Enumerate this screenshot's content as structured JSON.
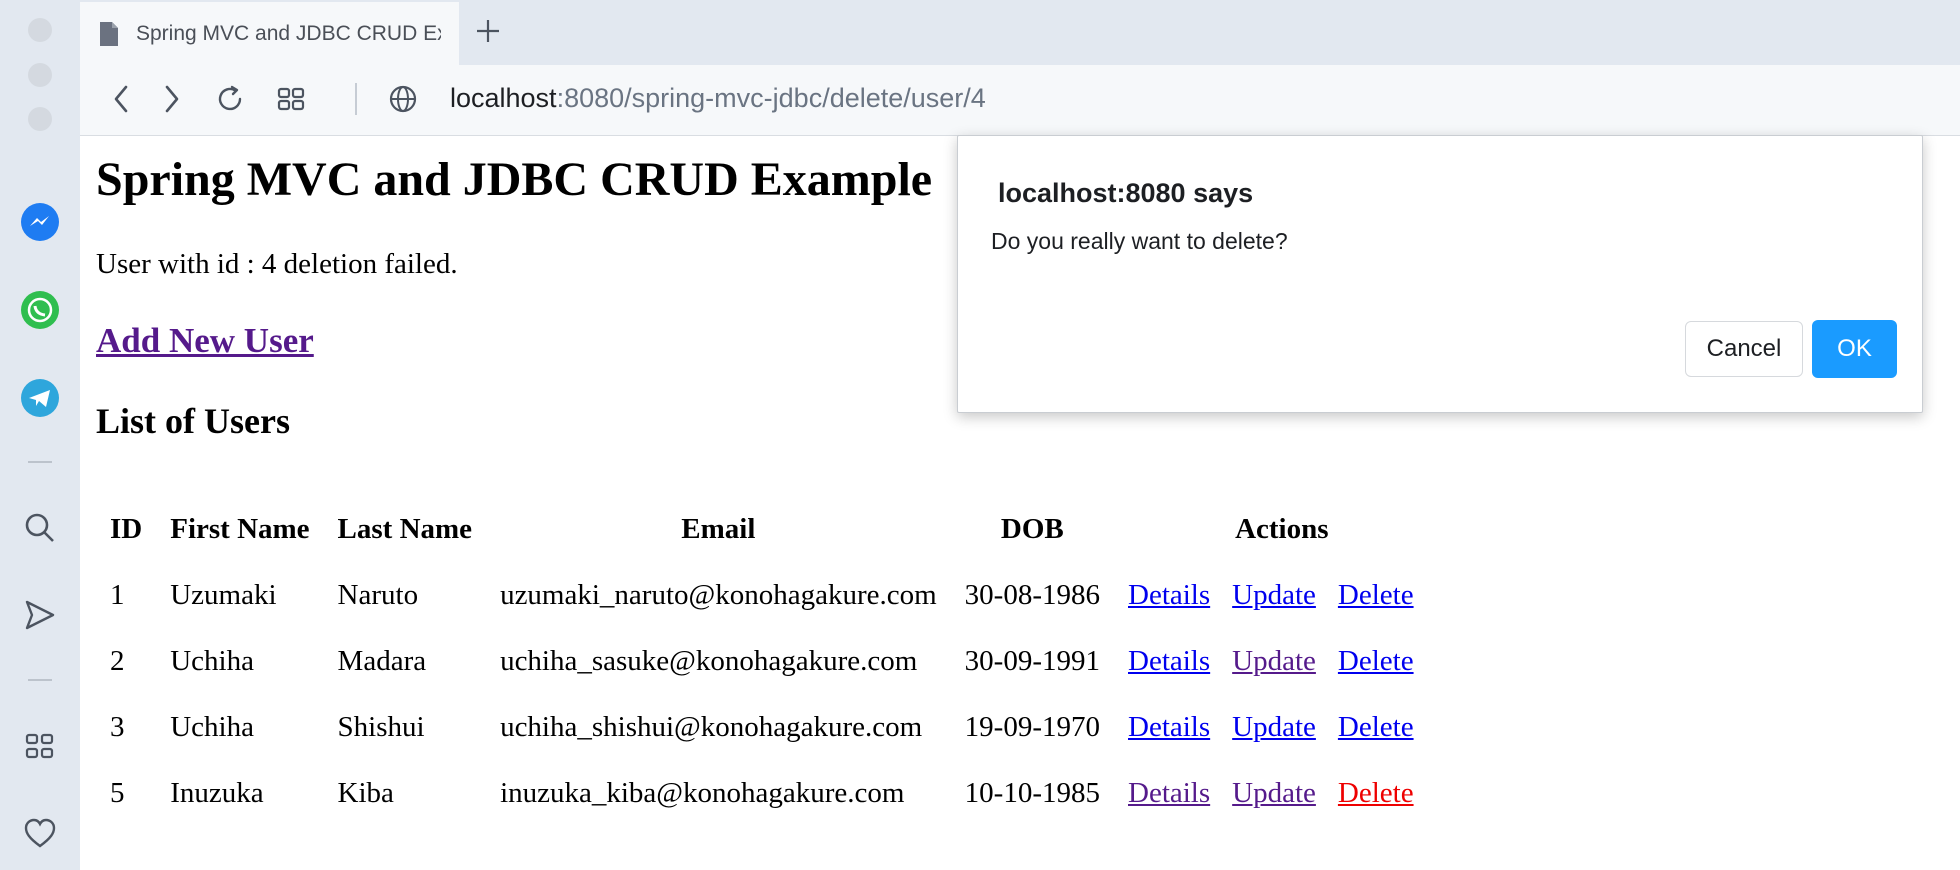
{
  "browser": {
    "tab": {
      "title": "Spring MVC and JDBC CRUD Example"
    },
    "url": {
      "host": "localhost",
      "path": ":8080/spring-mvc-jdbc/delete/user/4"
    }
  },
  "sidebar": {
    "items": [
      {
        "icon": "messenger-icon"
      },
      {
        "icon": "whatsapp-icon"
      },
      {
        "icon": "telegram-icon"
      },
      {
        "icon": "search-icon"
      },
      {
        "icon": "send-icon"
      },
      {
        "icon": "apps-grid-icon"
      },
      {
        "icon": "heart-icon"
      }
    ]
  },
  "page": {
    "title": "Spring MVC and JDBC CRUD Example",
    "message": "User with id : 4 deletion failed.",
    "add_link": "Add New User",
    "list_heading": "List of Users",
    "table": {
      "headers": {
        "id": "ID",
        "first": "First Name",
        "last": "Last Name",
        "email": "Email",
        "dob": "DOB",
        "actions": "Actions"
      },
      "rows": [
        {
          "id": "1",
          "first": "Uzumaki",
          "last": "Naruto",
          "email": "uzumaki_naruto@konohagakure.com",
          "dob": "30-08-1986",
          "details": "Details",
          "update": "Update",
          "delete": "Delete"
        },
        {
          "id": "2",
          "first": "Uchiha",
          "last": "Madara",
          "email": "uchiha_sasuke@konohagakure.com",
          "dob": "30-09-1991",
          "details": "Details",
          "update": "Update",
          "delete": "Delete"
        },
        {
          "id": "3",
          "first": "Uchiha",
          "last": "Shishui",
          "email": "uchiha_shishui@konohagakure.com",
          "dob": "19-09-1970",
          "details": "Details",
          "update": "Update",
          "delete": "Delete"
        },
        {
          "id": "5",
          "first": "Inuzuka",
          "last": "Kiba",
          "email": "inuzuka_kiba@konohagakure.com",
          "dob": "10-10-1985",
          "details": "Details",
          "update": "Update",
          "delete": "Delete"
        }
      ]
    }
  },
  "dialog": {
    "title": "localhost:8080 says",
    "message": "Do you really want to delete?",
    "cancel_label": "Cancel",
    "ok_label": "OK"
  },
  "colors": {
    "ok_button": "#1a9bff",
    "visited_link": "#551a8b",
    "link": "#0000ee",
    "active_link": "#ee0000"
  }
}
